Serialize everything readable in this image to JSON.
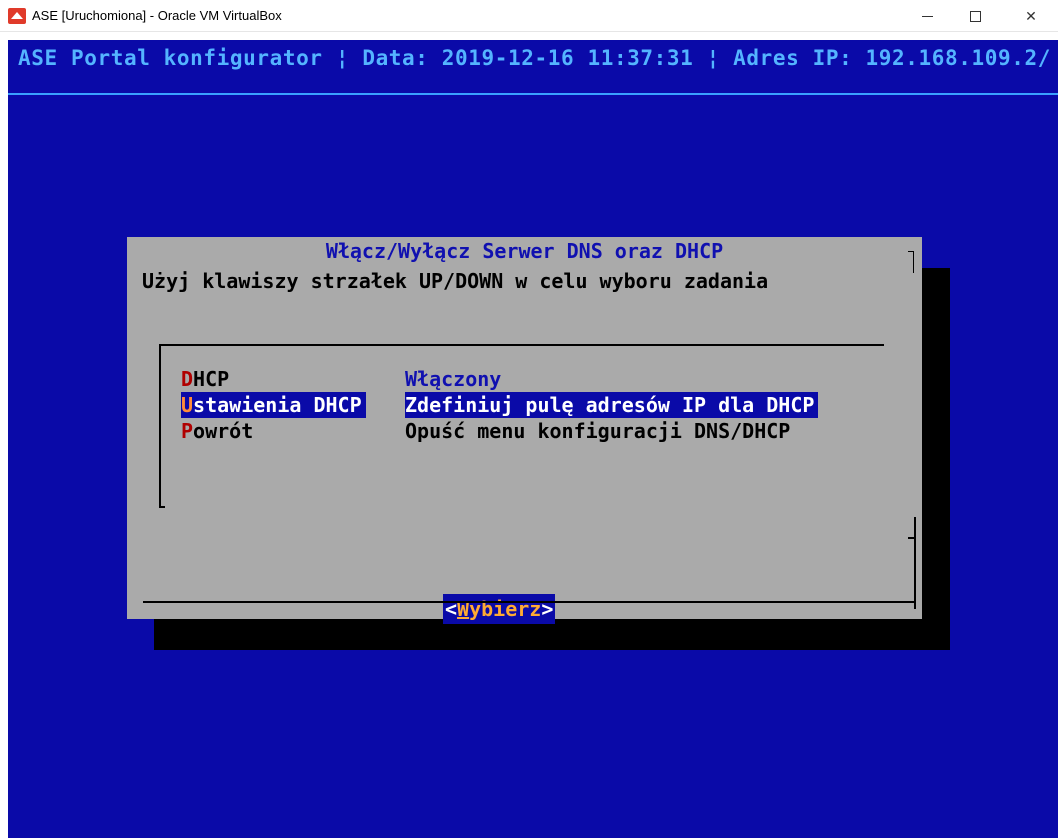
{
  "window": {
    "title": "ASE [Uruchomiona] - Oracle VM VirtualBox",
    "close_glyph": "✕"
  },
  "console": {
    "header": "ASE Portal konfigurator ¦ Data: 2019-12-16 11:37:31 ¦ Adres IP: 192.168.109.2/"
  },
  "dialog": {
    "title": "Włącz/Wyłącz Serwer DNS oraz DHCP",
    "subtitle": "Użyj klawiszy strzałek UP/DOWN w celu wyboru zadania",
    "items": [
      {
        "hotkey": "D",
        "rest": "HCP",
        "description": "Włączony",
        "selected": false
      },
      {
        "hotkey": "U",
        "rest": "stawienia DHCP",
        "description": "Zdefiniuj pulę adresów IP dla DHCP",
        "selected": true
      },
      {
        "hotkey": "P",
        "rest": "owrót",
        "description": "Opuść menu konfiguracji DNS/DHCP",
        "selected": false
      }
    ],
    "button": {
      "open": "<",
      "hotkey": "W",
      "rest": "ybierz",
      "close": ">"
    }
  },
  "colors": {
    "console_bg": "#0a0aa8",
    "dialog_bg": "#aaaaaa",
    "header_text": "#54b4ff",
    "hotkey": "#b00000",
    "selected_bg": "#0a0aa8"
  }
}
